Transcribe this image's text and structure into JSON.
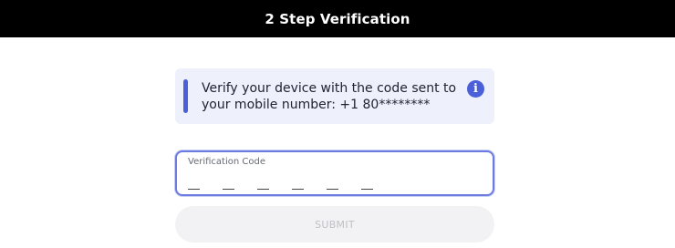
{
  "header": {
    "title": "2 Step Verification"
  },
  "info_box": {
    "message": "Verify your device with the code sent to your mobile number: +1 80********",
    "icon": "info-icon",
    "icon_glyph": "i",
    "accent_color": "#4b5fd8"
  },
  "verification_field": {
    "label": "Verification Code",
    "digit_count": 6,
    "digits": [
      "",
      "",
      "",
      "",
      "",
      ""
    ]
  },
  "submit": {
    "label": "SUBMIT",
    "disabled": true
  }
}
